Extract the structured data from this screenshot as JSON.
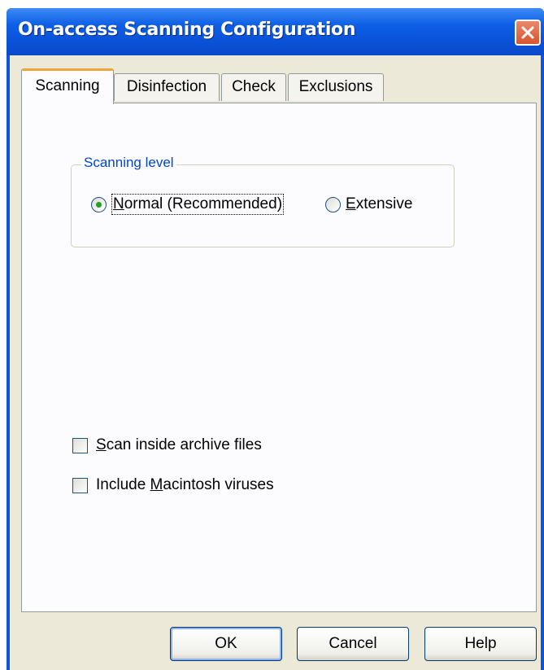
{
  "window": {
    "title": "On-access Scanning Configuration",
    "close_icon": "close-icon"
  },
  "tabs": [
    {
      "label": "Scanning",
      "active": true
    },
    {
      "label": "Disinfection",
      "active": false
    },
    {
      "label": "Check",
      "active": false
    },
    {
      "label": "Exclusions",
      "active": false
    }
  ],
  "scanning_level": {
    "label": "Scanning level",
    "options": [
      {
        "label": "Normal (Recommended)",
        "mnemonic": "N",
        "rest": "ormal (Recommended)",
        "selected": true
      },
      {
        "label": "Extensive",
        "mnemonic": "E",
        "rest": "xtensive",
        "selected": false
      }
    ]
  },
  "options": [
    {
      "label": "Scan inside archive files",
      "prefix": "",
      "mnemonic": "S",
      "rest": "can inside archive files",
      "checked": false
    },
    {
      "label": "Include Macintosh viruses",
      "prefix": "Include ",
      "mnemonic": "M",
      "rest": "acintosh viruses",
      "checked": false
    }
  ],
  "buttons": {
    "ok": "OK",
    "cancel": "Cancel",
    "help": "Help"
  },
  "colors": {
    "title_bar": "#0a54e0",
    "accent_tab": "#f2a33a",
    "group_label": "#0046d5",
    "close_button": "#d9532e"
  }
}
